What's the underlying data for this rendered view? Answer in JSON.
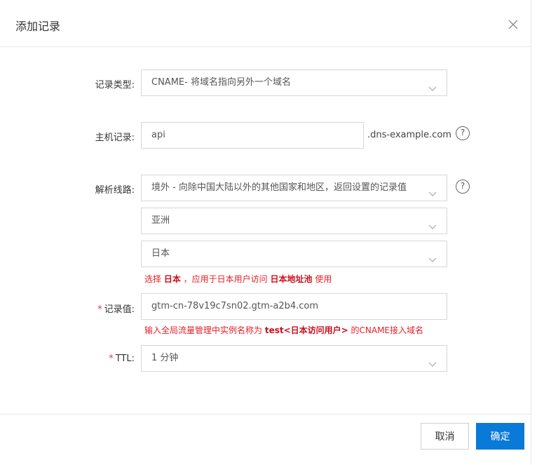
{
  "dialog": {
    "title": "添加记录",
    "close_icon": "close-icon"
  },
  "form": {
    "record_type": {
      "label": "记录类型:",
      "value": "CNAME- 将域名指向另外一个域名"
    },
    "host": {
      "label": "主机记录:",
      "value": "api",
      "suffix": ".dns-example.com",
      "help": "?"
    },
    "line": {
      "label": "解析线路:",
      "value": "境外 - 向除中国大陆以外的其他国家和地区，返回设置的记录值",
      "help": "?",
      "region": "亚洲",
      "country": "日本",
      "hint": {
        "prefix": "选择 ",
        "bold1": "日本",
        "middle": " ，应用于日本用户访问 ",
        "bold2": "日本地址池",
        "suffix": " 使用"
      }
    },
    "record_value": {
      "required": "*",
      "label": "记录值:",
      "value": "gtm-cn-78v19c7sn02.gtm-a2b4.com",
      "hint": {
        "prefix": "输入全局流量管理中实例名称为 ",
        "bold": "test<日本访问用户>",
        "suffix": " 的CNAME接入域名"
      }
    },
    "ttl": {
      "required": "*",
      "label": "TTL:",
      "value": "1 分钟"
    }
  },
  "footer": {
    "cancel_label": "取消",
    "confirm_label": "确定"
  },
  "colors": {
    "primary": "#0a7ad8",
    "hint_red": "#e4202a",
    "required_red": "#e4393c"
  }
}
